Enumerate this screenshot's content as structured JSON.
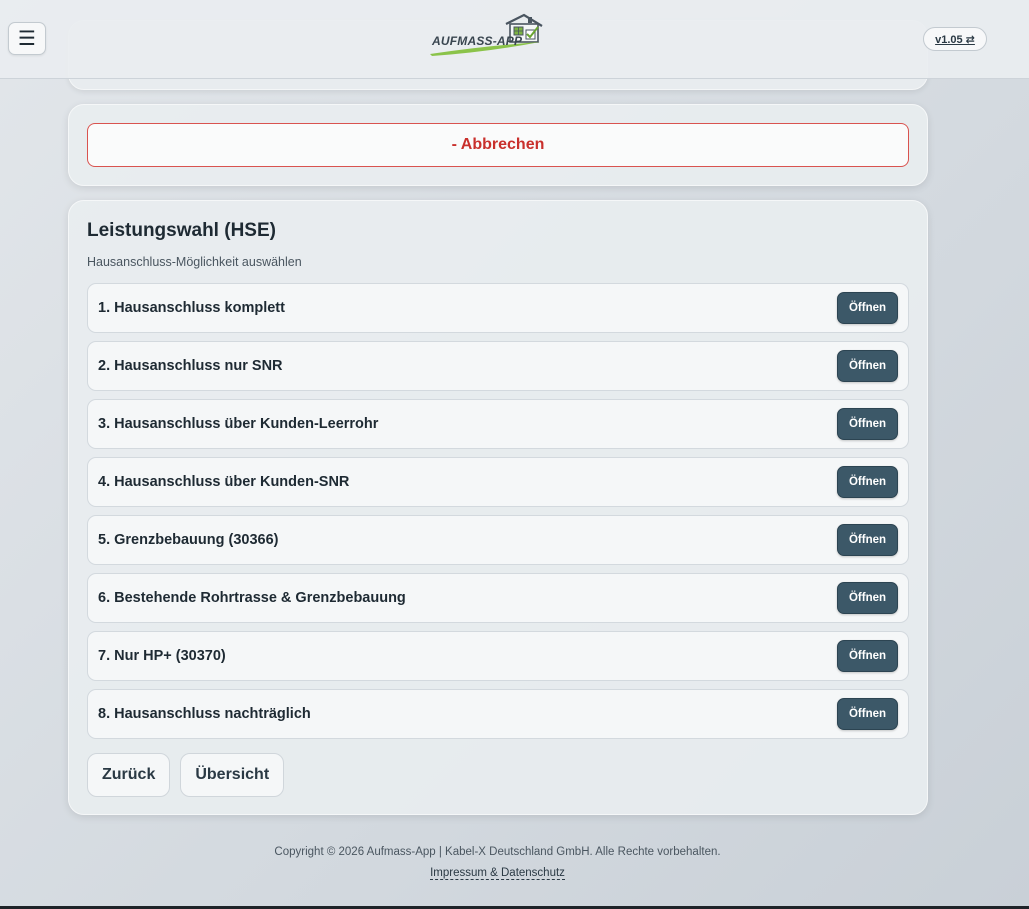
{
  "header": {
    "menu_icon": "☰",
    "logo_text": "AUFMASS-APP",
    "version_label": "v1.05 ⇄"
  },
  "cancel": {
    "label": "- Abbrechen"
  },
  "section": {
    "title": "Leistungswahl (HSE)",
    "subtitle": "Hausanschluss-Möglichkeit auswählen",
    "open_label": "Öffnen",
    "options": [
      {
        "label": "1. Hausanschluss komplett"
      },
      {
        "label": "2. Hausanschluss nur SNR"
      },
      {
        "label": "3. Hausanschluss über Kunden-Leerrohr"
      },
      {
        "label": "4. Hausanschluss über Kunden-SNR"
      },
      {
        "label": "5. Grenzbebauung (30366)"
      },
      {
        "label": "6. Bestehende Rohrtrasse & Grenzbebauung"
      },
      {
        "label": "7. Nur HP+ (30370)"
      },
      {
        "label": "8. Hausanschluss nachträglich"
      }
    ]
  },
  "nav": {
    "back_label": "Zurück",
    "overview_label": "Übersicht"
  },
  "footer": {
    "copyright": "Copyright © 2026 Aufmass-App | Kabel-X Deutschland GmbH. Alle Rechte vorbehalten.",
    "legal_link": "Impressum & Datenschutz"
  },
  "colors": {
    "accent_dark": "#3c5868",
    "cancel_red": "#c9302c",
    "logo_green": "#7cb342"
  }
}
